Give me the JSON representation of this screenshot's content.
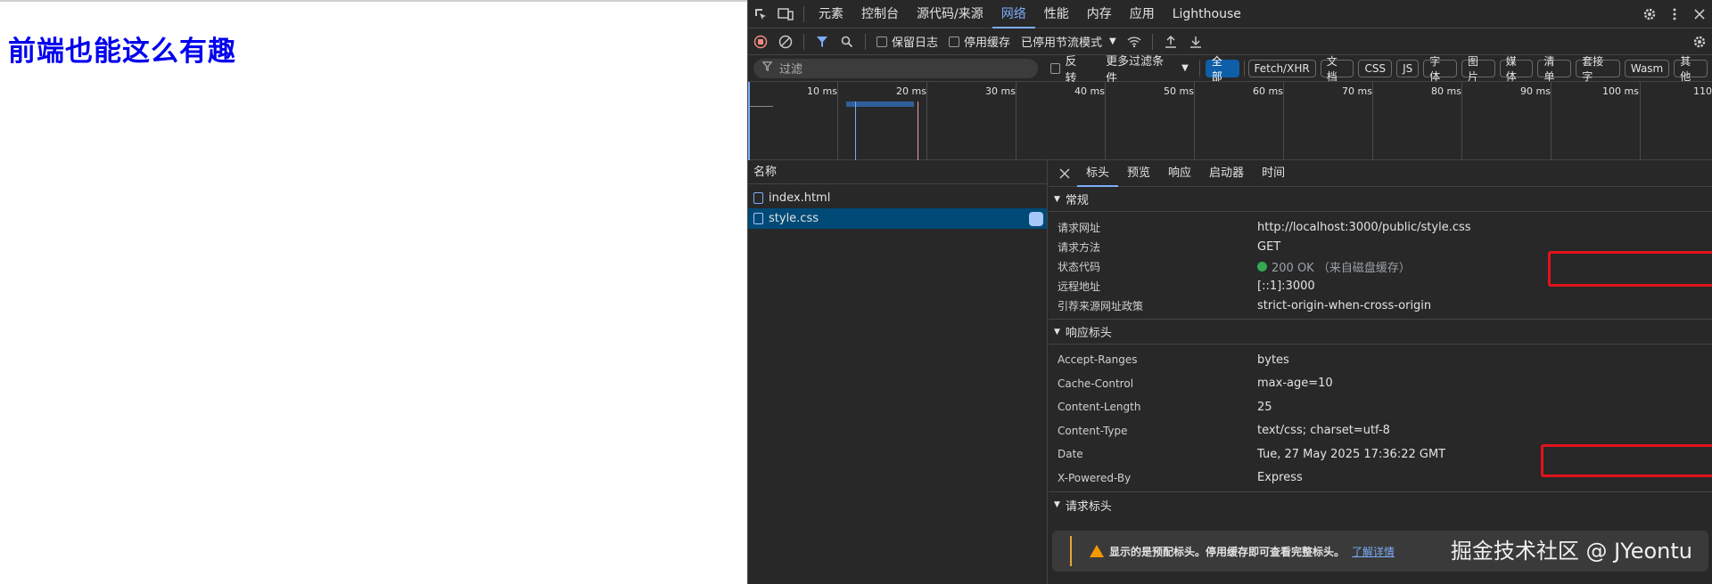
{
  "page": {
    "heading": "前端也能这么有趣"
  },
  "devtools": {
    "panels": [
      "元素",
      "控制台",
      "源代码/来源",
      "网络",
      "性能",
      "内存",
      "应用",
      "Lighthouse"
    ],
    "active_panel": "网络",
    "toolbar": {
      "preserve_log": "保留日志",
      "disable_cache": "停用缓存",
      "throttle": "已停用节流模式"
    },
    "filter": {
      "placeholder": "过滤",
      "invert": "反转",
      "more_filters": "更多过滤条件",
      "types": [
        "全部",
        "Fetch/XHR",
        "文档",
        "CSS",
        "JS",
        "字体",
        "图片",
        "媒体",
        "清单",
        "套接字",
        "Wasm",
        "其他"
      ],
      "active_type": "全部"
    },
    "timeline": {
      "ticks": [
        "10 ms",
        "20 ms",
        "30 ms",
        "40 ms",
        "50 ms",
        "60 ms",
        "70 ms",
        "80 ms",
        "90 ms",
        "100 ms",
        "110"
      ]
    },
    "requests": {
      "header": "名称",
      "items": [
        "index.html",
        "style.css"
      ],
      "selected": "style.css"
    },
    "details": {
      "tabs": [
        "标头",
        "预览",
        "响应",
        "启动器",
        "时间"
      ],
      "active_tab": "标头",
      "general": {
        "title": "常规",
        "rows": [
          {
            "k": "请求网址",
            "v": "http://localhost:3000/public/style.css"
          },
          {
            "k": "请求方法",
            "v": "GET"
          },
          {
            "k": "状态代码",
            "v": "200 OK  （来自磁盘缓存）"
          },
          {
            "k": "远程地址",
            "v": "[::1]:3000"
          },
          {
            "k": "引荐来源网址政策",
            "v": "strict-origin-when-cross-origin"
          }
        ]
      },
      "response_headers": {
        "title": "响应标头",
        "rows": [
          {
            "k": "Accept-Ranges",
            "v": "bytes"
          },
          {
            "k": "Cache-Control",
            "v": "max-age=10"
          },
          {
            "k": "Content-Length",
            "v": "25"
          },
          {
            "k": "Content-Type",
            "v": "text/css; charset=utf-8"
          },
          {
            "k": "Date",
            "v": "Tue, 27 May 2025 17:36:22 GMT"
          },
          {
            "k": "X-Powered-By",
            "v": "Express"
          }
        ]
      },
      "request_headers": {
        "title": "请求标头",
        "warning": "显示的是预配标头。停用缓存即可查看完整标头。",
        "learn_more": "了解详情"
      }
    }
  },
  "watermark": "掘金技术社区 @ JYeontu",
  "colors": {
    "accent": "#7cacf8",
    "highlight": "#e3121b",
    "status_ok": "#34a853",
    "link": "#0000ee"
  }
}
